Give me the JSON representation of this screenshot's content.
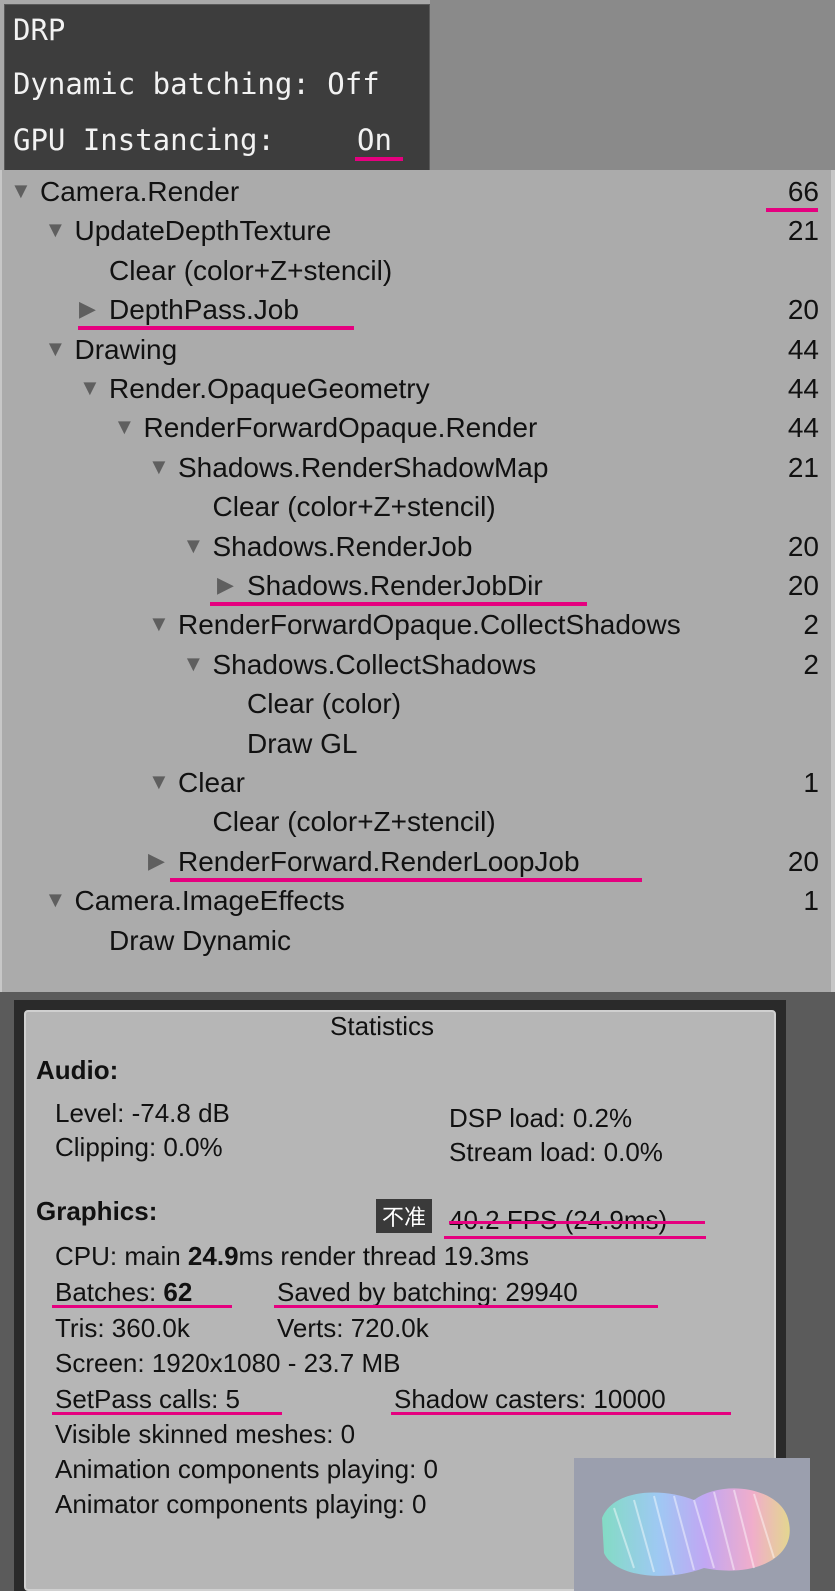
{
  "overlay": {
    "line1": "DRP",
    "line2": "Dynamic batching: Off",
    "line3_label": "GPU Instancing:",
    "line3_value": "On"
  },
  "tree": [
    {
      "label": "Camera.Render",
      "count": "66",
      "depth": 0,
      "arrow": "down"
    },
    {
      "label": "UpdateDepthTexture",
      "count": "21",
      "depth": 1,
      "arrow": "down"
    },
    {
      "label": "Clear (color+Z+stencil)",
      "count": "",
      "depth": 2,
      "arrow": "none"
    },
    {
      "label": "DepthPass.Job",
      "count": "20",
      "depth": 2,
      "arrow": "right"
    },
    {
      "label": "Drawing",
      "count": "44",
      "depth": 1,
      "arrow": "down"
    },
    {
      "label": "Render.OpaqueGeometry",
      "count": "44",
      "depth": 2,
      "arrow": "down"
    },
    {
      "label": "RenderForwardOpaque.Render",
      "count": "44",
      "depth": 3,
      "arrow": "down"
    },
    {
      "label": "Shadows.RenderShadowMap",
      "count": "21",
      "depth": 4,
      "arrow": "down"
    },
    {
      "label": "Clear (color+Z+stencil)",
      "count": "",
      "depth": 5,
      "arrow": "none"
    },
    {
      "label": "Shadows.RenderJob",
      "count": "20",
      "depth": 5,
      "arrow": "down"
    },
    {
      "label": "Shadows.RenderJobDir",
      "count": "20",
      "depth": 6,
      "arrow": "right"
    },
    {
      "label": "RenderForwardOpaque.CollectShadows",
      "count": "2",
      "depth": 4,
      "arrow": "down"
    },
    {
      "label": "Shadows.CollectShadows",
      "count": "2",
      "depth": 5,
      "arrow": "down"
    },
    {
      "label": "Clear (color)",
      "count": "",
      "depth": 6,
      "arrow": "none"
    },
    {
      "label": "Draw GL",
      "count": "",
      "depth": 6,
      "arrow": "none"
    },
    {
      "label": "Clear",
      "count": "1",
      "depth": 4,
      "arrow": "down"
    },
    {
      "label": "Clear (color+Z+stencil)",
      "count": "",
      "depth": 5,
      "arrow": "none"
    },
    {
      "label": "RenderForward.RenderLoopJob",
      "count": "20",
      "depth": 4,
      "arrow": "right"
    },
    {
      "label": "Camera.ImageEffects",
      "count": "1",
      "depth": 1,
      "arrow": "down"
    },
    {
      "label": "Draw Dynamic",
      "count": "",
      "depth": 2,
      "arrow": "none"
    }
  ],
  "stats": {
    "title": "Statistics",
    "audio_heading": "Audio:",
    "level": "Level: -74.8 dB",
    "clipping": "Clipping: 0.0%",
    "dsp_load": "DSP load: 0.2%",
    "stream_load": "Stream load: 0.0%",
    "graphics_heading": "Graphics:",
    "badge": "不准",
    "fps": "40.2 FPS (24.9ms)",
    "cpu_prefix": "CPU: main ",
    "cpu_main": "24.9",
    "cpu_suffix": "ms  render thread 19.3ms",
    "batches_label": "Batches: ",
    "batches_value": "62",
    "saved_by_batching": "Saved by batching: 29940",
    "tris": "Tris: 360.0k",
    "verts": "Verts: 720.0k",
    "screen": "Screen: 1920x1080 - 23.7 MB",
    "setpass": "SetPass calls: 5",
    "shadow_casters": "Shadow casters: 10000",
    "skinned": "Visible skinned meshes: 0",
    "animation": "Animation components playing: 0",
    "animator": "Animator components playing: 0"
  },
  "colors": {
    "accent_underline": "#e5007f"
  }
}
